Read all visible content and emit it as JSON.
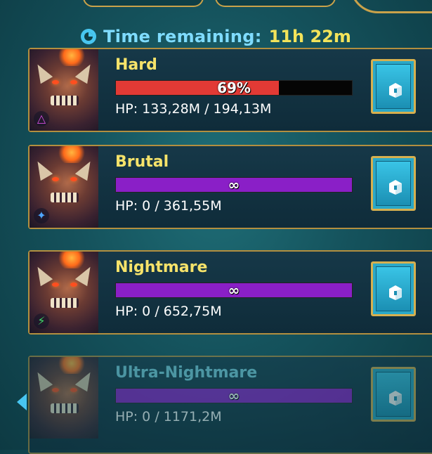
{
  "timer": {
    "label": "Time remaining:",
    "value": "11h 22m"
  },
  "rows": [
    {
      "difficulty": "Hard",
      "bar_text": "69%",
      "progress": 0.69,
      "hp": "HP: 133,28M / 194,13M",
      "affinity_icon": "triangle-icon"
    },
    {
      "difficulty": "Brutal",
      "bar_text": "∞",
      "progress": 1.0,
      "hp": "HP: 0 / 361,55M",
      "affinity_icon": "magic-icon"
    },
    {
      "difficulty": "Nightmare",
      "bar_text": "∞",
      "progress": 1.0,
      "hp": "HP: 0 / 652,75M",
      "affinity_icon": "force-icon"
    },
    {
      "difficulty": "Ultra-Nightmare",
      "bar_text": "∞",
      "progress": 1.0,
      "hp": "HP: 0 / 1171,2M",
      "affinity_icon": "void-icon"
    }
  ],
  "colors": {
    "accent_gold": "#d6b04f",
    "title_yellow": "#f6e36a",
    "bar_red": "#e23a35",
    "bar_purple": "#8a1fc7"
  }
}
